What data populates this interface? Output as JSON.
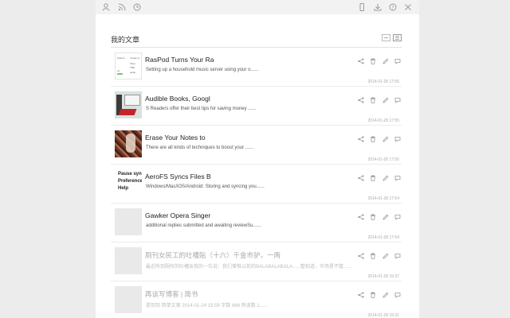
{
  "toolbar": {
    "left_icons": [
      "user-icon",
      "rss-icon",
      "clock-icon"
    ],
    "right_icons": [
      "phone-icon",
      "download-icon",
      "help-icon",
      "close-icon"
    ]
  },
  "section": {
    "title": "我的文章",
    "views": [
      "list-view",
      "detail-view"
    ]
  },
  "articles": [
    {
      "title": "RasPod Turns Your Ra",
      "excerpt": "Setting up a household music server using your o......",
      "date": "2014-01-28 17:55",
      "thumb": "screenshot",
      "thumb_text": [
        "Search",
        "Create H",
        "Shoo",
        "TBE",
        "settie",
        "up"
      ]
    },
    {
      "title": "Audible Books, Googl",
      "excerpt": "S Readers offer their best tips for saving money ......",
      "date": "2014-01-28 17:55",
      "thumb": "book"
    },
    {
      "title": "Erase Your Notes to",
      "excerpt": "There are all kinds of techniques to boost your ......",
      "date": "2014-01-28 17:55",
      "thumb": "photo"
    },
    {
      "title": "AeroFS Syncs Files B",
      "excerpt": "Windows/Mac/iOS/Android: Storing and syncing you......",
      "date": "2014-01-28 17:54",
      "thumb": "text",
      "thumb_text": [
        "Pause sync",
        "Preference",
        "Help"
      ]
    },
    {
      "title": "Gawker Opera Singer",
      "excerpt": "additional replies submitted and awaiting reviewSu......",
      "date": "2014-01-28 17:54",
      "thumb": "grey"
    },
    {
      "title": "厕刊女民工的吐槽贴（十六）千金市驴，一两",
      "excerpt": "最近所到厕所的吐槽亲我的一位说：我们憎惟以前的BALABALABALA......整知道，市场是不管......",
      "date": "2014-01-28 15:37",
      "thumb": "grey",
      "dim": true
    },
    {
      "title": "再谈写博客 | 简书",
      "excerpt": "提到到 简单文案 2014-01-24 19:59 字数 666 熟读数 1......",
      "date": "2014-01-28 15:31",
      "thumb": "grey",
      "dim": true
    }
  ],
  "row_actions": [
    "share-icon",
    "delete-icon",
    "edit-icon",
    "comment-icon"
  ],
  "colors": {
    "background": "#ececec",
    "panel": "#ffffff",
    "toolbar": "#f2f2f2",
    "icon": "#9a9a9a"
  }
}
